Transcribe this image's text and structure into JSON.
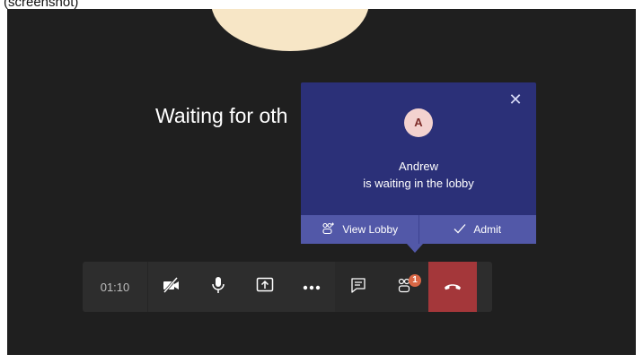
{
  "caption": "(screenshot)",
  "meeting": {
    "waiting_message": "Waiting for oth"
  },
  "lobby_popup": {
    "avatar_initial": "A",
    "participant_name": "Andrew",
    "message": "is waiting in the lobby",
    "view_lobby_label": "View Lobby",
    "admit_label": "Admit"
  },
  "toolbar": {
    "timer": "01:10",
    "people_badge_count": "1"
  },
  "colors": {
    "stage_bg": "#1f1f1f",
    "popup_bg": "#2b3078",
    "popup_actions_bg": "#5258a8",
    "hangup_red": "#a4373a",
    "badge_orange": "#d96745"
  }
}
